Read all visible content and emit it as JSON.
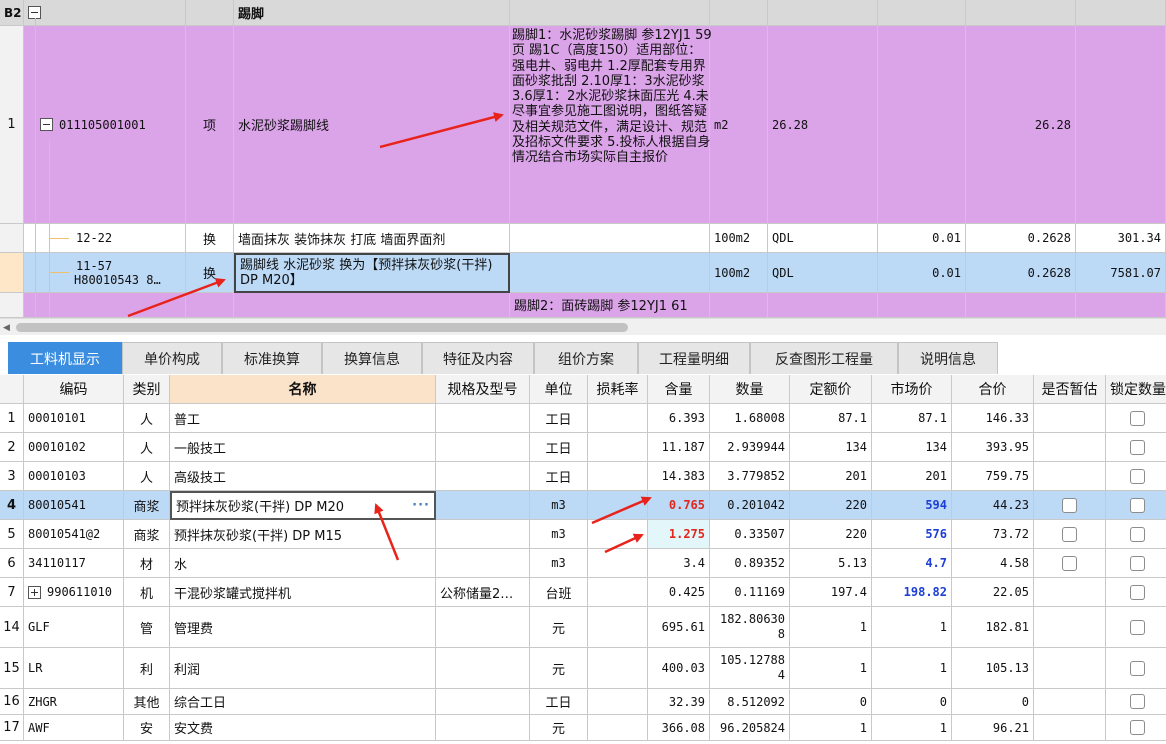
{
  "top_grid": {
    "header_row": {
      "label": "B2",
      "name": "踢脚"
    },
    "rows": [
      {
        "num": "1",
        "code": "011105001001",
        "type": "项",
        "name": "水泥砂浆踢脚线",
        "description": "踢脚1：水泥砂浆踢脚 参12YJ1 59页 踢1C（高度150）适用部位：强电井、弱电井 1.2厚配套专用界面砂浆批刮 2.10厚1：3水泥砂浆 3.6厚1：2水泥砂浆抹面压光 4.未尽事宜参见施工图说明，图纸答疑及相关规范文件，满足设计、规范及招标文件要求 5.投标人根据自身情况结合市场实际自主报价",
        "unit": "m2",
        "qty_expr": "26.28",
        "qty": "26.28"
      },
      {
        "num": "",
        "code": "12-22",
        "type": "换",
        "name": "墙面抹灰 装饰抹灰 打底 墙面界面剂",
        "unit": "100m2",
        "qty_expr": "QDL",
        "content": "0.01",
        "qty": "0.2628",
        "price": "301.34"
      },
      {
        "num": "",
        "code": "11-57",
        "code2": "H80010543 8…",
        "type": "换",
        "name": "踢脚线 水泥砂浆  换为【预拌抹灰砂浆(干拌) DP M20】",
        "unit": "100m2",
        "qty_expr": "QDL",
        "content": "0.01",
        "qty": "0.2628",
        "price": "7581.07"
      },
      {
        "num": "",
        "description": "踢脚2：面砖踢脚 参12YJ1 61"
      }
    ]
  },
  "tabs": [
    {
      "label": "工料机显示",
      "active": true
    },
    {
      "label": "单价构成"
    },
    {
      "label": "标准换算"
    },
    {
      "label": "换算信息"
    },
    {
      "label": "特征及内容"
    },
    {
      "label": "组价方案"
    },
    {
      "label": "工程量明细"
    },
    {
      "label": "反查图形工程量"
    },
    {
      "label": "说明信息"
    }
  ],
  "bottom_grid": {
    "columns": [
      "编码",
      "类别",
      "名称",
      "规格及型号",
      "单位",
      "损耗率",
      "含量",
      "数量",
      "定额价",
      "市场价",
      "合价",
      "是否暂估",
      "锁定数量"
    ],
    "rows": [
      {
        "num": "1",
        "code": "00010101",
        "cat": "人",
        "name": "普工",
        "spec": "",
        "unit": "工日",
        "loss": "",
        "content": "6.393",
        "qty": "1.68008",
        "base": "87.1",
        "market": "87.1",
        "total": "146.33",
        "est": false
      },
      {
        "num": "2",
        "code": "00010102",
        "cat": "人",
        "name": "一般技工",
        "spec": "",
        "unit": "工日",
        "loss": "",
        "content": "11.187",
        "qty": "2.939944",
        "base": "134",
        "market": "134",
        "total": "393.95",
        "est": false
      },
      {
        "num": "3",
        "code": "00010103",
        "cat": "人",
        "name": "高级技工",
        "spec": "",
        "unit": "工日",
        "loss": "",
        "content": "14.383",
        "qty": "3.779852",
        "base": "201",
        "market": "201",
        "total": "759.75",
        "est": false
      },
      {
        "num": "4",
        "code": "80010541",
        "cat": "商浆",
        "name": "预拌抹灰砂浆(干拌) DP M20",
        "spec": "",
        "unit": "m3",
        "loss": "",
        "content": "0.765",
        "qty": "0.201042",
        "base": "220",
        "market": "594",
        "total": "44.23",
        "est": true
      },
      {
        "num": "5",
        "code": "80010541@2",
        "cat": "商浆",
        "name": "预拌抹灰砂浆(干拌) DP M15",
        "spec": "",
        "unit": "m3",
        "loss": "",
        "content": "1.275",
        "qty": "0.33507",
        "base": "220",
        "market": "576",
        "total": "73.72",
        "est": true
      },
      {
        "num": "6",
        "code": "34110117",
        "cat": "材",
        "name": "水",
        "spec": "",
        "unit": "m3",
        "loss": "",
        "content": "3.4",
        "qty": "0.89352",
        "base": "5.13",
        "market": "4.7",
        "total": "4.58",
        "est": true
      },
      {
        "num": "7",
        "code": "990611010",
        "cat": "机",
        "name": "干混砂浆罐式搅拌机",
        "spec": "公称储量2…",
        "unit": "台班",
        "loss": "",
        "content": "0.425",
        "qty": "0.11169",
        "base": "197.4",
        "market": "198.82",
        "total": "22.05",
        "est": false
      },
      {
        "num": "14",
        "code": "GLF",
        "cat": "管",
        "name": "管理费",
        "spec": "",
        "unit": "元",
        "loss": "",
        "content": "695.61",
        "qty": "182.806308",
        "base": "1",
        "market": "1",
        "total": "182.81",
        "est": false
      },
      {
        "num": "15",
        "code": "LR",
        "cat": "利",
        "name": "利润",
        "spec": "",
        "unit": "元",
        "loss": "",
        "content": "400.03",
        "qty": "105.127884",
        "base": "1",
        "market": "1",
        "total": "105.13",
        "est": false
      },
      {
        "num": "16",
        "code": "ZHGR",
        "cat": "其他",
        "name": "综合工日",
        "spec": "",
        "unit": "工日",
        "loss": "",
        "content": "32.39",
        "qty": "8.512092",
        "base": "0",
        "market": "0",
        "total": "0",
        "est": false
      },
      {
        "num": "17",
        "code": "AWF",
        "cat": "安",
        "name": "安文费",
        "spec": "",
        "unit": "元",
        "loss": "",
        "content": "366.08",
        "qty": "96.205824",
        "base": "1",
        "market": "1",
        "total": "96.21",
        "est": false
      }
    ],
    "qty_split": {
      "r14a": "182.80630",
      "r14b": "8",
      "r15a": "105.12788",
      "r15b": "4"
    }
  },
  "colors": {
    "pink_row": "#dba4e9",
    "selected_row": "#bcd9f6",
    "active_tab": "#3b8de0",
    "annotation_arrow": "#e8231b",
    "market_price_blue": "#1d3fd6"
  }
}
